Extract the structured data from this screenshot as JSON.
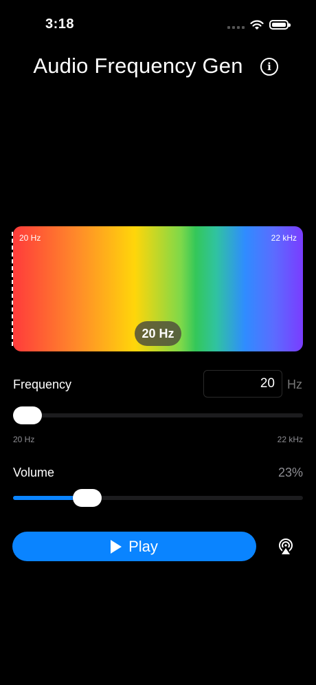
{
  "status_bar": {
    "time": "3:18",
    "icons": [
      "cellular-dots-icon",
      "wifi-icon",
      "battery-icon"
    ]
  },
  "header": {
    "title": "Audio Frequency Gen",
    "info_icon": "info-icon"
  },
  "spectrum": {
    "min_label": "20 Hz",
    "max_label": "22 kHz",
    "current_badge": "20 Hz",
    "gradient_colors": [
      "#ff3b3b",
      "#ff8a2a",
      "#ffd60a",
      "#34c759",
      "#2f8cff",
      "#7a3cff"
    ]
  },
  "frequency": {
    "label": "Frequency",
    "value": "20",
    "unit": "Hz",
    "range_min": "20 Hz",
    "range_max": "22 kHz",
    "slider_fraction": 0.0
  },
  "volume": {
    "label": "Volume",
    "value_text": "23%",
    "slider_fraction": 0.23
  },
  "play": {
    "label": "Play",
    "icon": "play-icon"
  },
  "airplay": {
    "icon": "airplay-audio-icon"
  },
  "colors": {
    "accent": "#0a84ff",
    "background": "#000000",
    "track": "#1c1c1e",
    "secondary_text": "#8e8e93"
  }
}
